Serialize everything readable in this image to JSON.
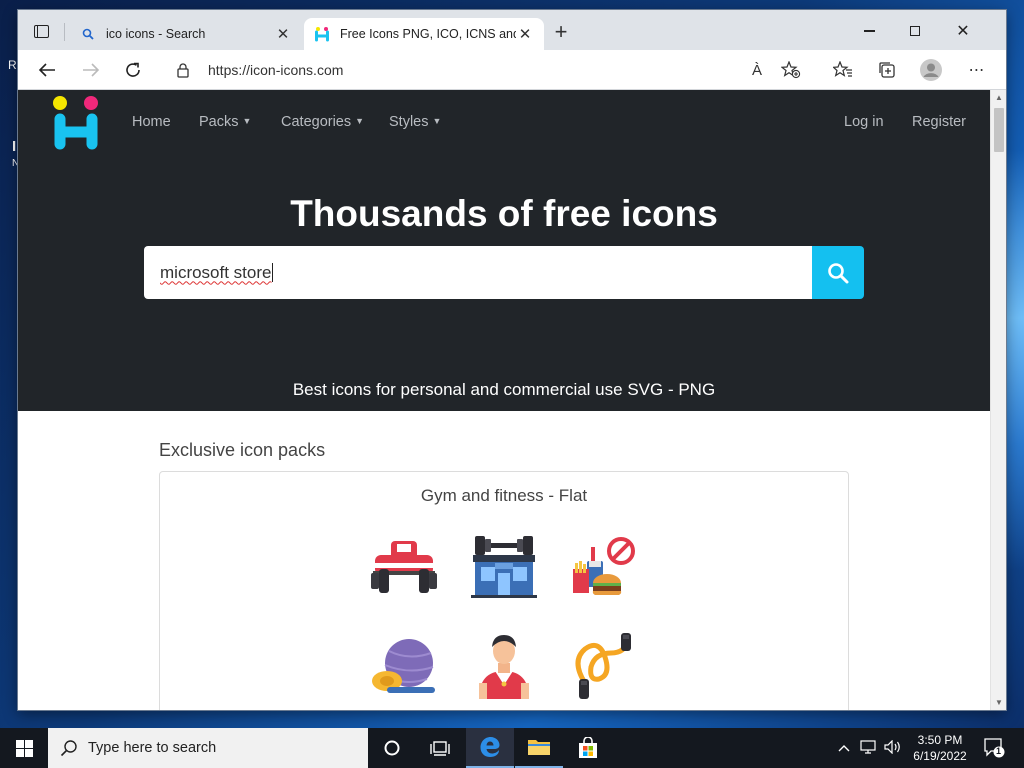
{
  "desktop": {
    "edge_text_1": "R",
    "edge_text_2": "I",
    "edge_text_3": "N"
  },
  "browser": {
    "tabs": [
      {
        "title": "ico icons - Search",
        "icon": "search-icon"
      },
      {
        "title": "Free Icons PNG, ICO, ICNS and S",
        "icon": "icon-icons-logo"
      }
    ],
    "new_tab": "+",
    "address": "https://icon-icons.com",
    "read_aloud": "À"
  },
  "site": {
    "nav": {
      "home": "Home",
      "packs": "Packs",
      "categories": "Categories",
      "styles": "Styles",
      "login": "Log in",
      "register": "Register"
    },
    "hero_title": "Thousands of free icons",
    "search_value": "microsoft store",
    "subtitle": "Best icons for personal and commercial use SVG - PNG",
    "colors": {
      "dark": "#212529",
      "accent": "#14c0f0",
      "logo_yellow": "#f5e600",
      "logo_pink": "#f0287a",
      "logo_cyan": "#19c3f0"
    }
  },
  "packs": {
    "section_title": "Exclusive icon packs",
    "card_title": "Gym and fitness - Flat",
    "icons": [
      "bench-press-icon",
      "gym-building-icon",
      "junk-food-forbidden-icon",
      "yoga-ball-mat-icon",
      "fitness-trainer-icon",
      "jump-rope-icon"
    ]
  },
  "taskbar": {
    "search_placeholder": "Type here to search",
    "time": "3:50 PM",
    "date": "6/19/2022",
    "notification_count": "1"
  }
}
